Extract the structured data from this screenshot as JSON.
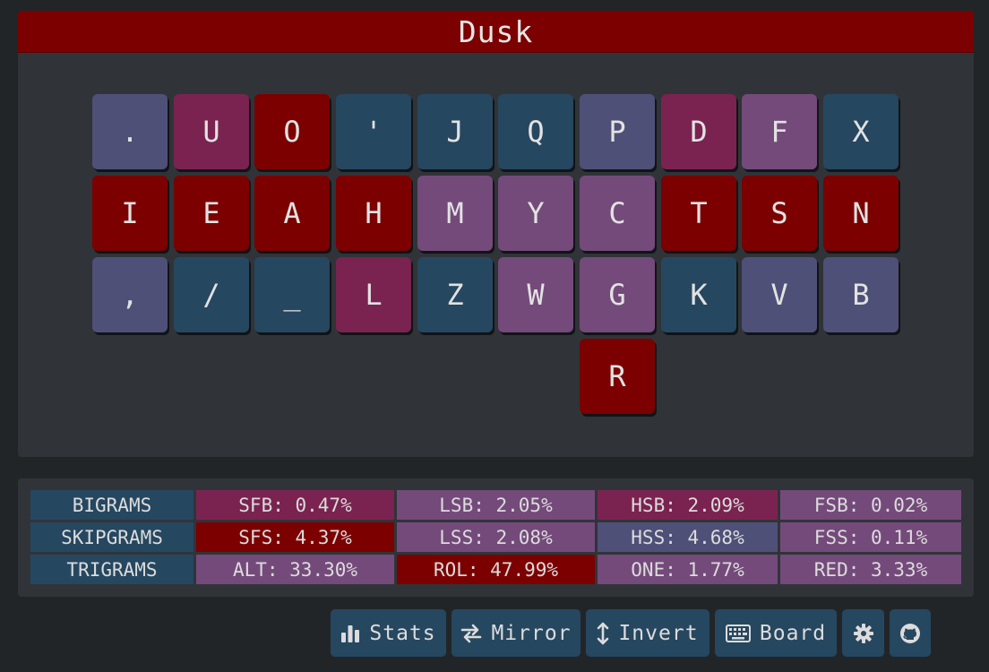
{
  "layout_name": "Dusk",
  "keys": [
    [
      ".",
      "U",
      "O",
      "'",
      "J",
      "Q",
      "P",
      "D",
      "F",
      "X"
    ],
    [
      "I",
      "E",
      "A",
      "H",
      "M",
      "Y",
      "C",
      "T",
      "S",
      "N"
    ],
    [
      ",",
      "/",
      "_",
      "L",
      "Z",
      "W",
      "G",
      "K",
      "V",
      "B"
    ],
    [
      "R"
    ]
  ],
  "key_colors": {
    "red": "#7c0000",
    "magenta": "#7a2350",
    "purple": "#744a7b",
    "slate": "#4f5078",
    "teal": "#264760"
  },
  "stats": {
    "rows": [
      {
        "label": "BIGRAMS",
        "cells": [
          "SFB: 0.47%",
          "LSB: 2.05%",
          "HSB: 2.09%",
          "FSB: 0.02%"
        ]
      },
      {
        "label": "SKIPGRAMS",
        "cells": [
          "SFS: 4.37%",
          "LSS: 2.08%",
          "HSS: 4.68%",
          "FSS: 0.11%"
        ]
      },
      {
        "label": "TRIGRAMS",
        "cells": [
          "ALT: 33.30%",
          "ROL: 47.99%",
          "ONE: 1.77%",
          "RED: 3.33%"
        ]
      }
    ]
  },
  "toolbar": {
    "stats_label": "Stats",
    "mirror_label": "Mirror",
    "invert_label": "Invert",
    "board_label": "Board",
    "stats_icon": "bar-chart-icon",
    "mirror_icon": "swap-arrows-icon",
    "invert_icon": "vertical-arrows-icon",
    "board_icon": "keyboard-icon",
    "settings_icon": "gear-icon",
    "github_icon": "github-icon"
  }
}
